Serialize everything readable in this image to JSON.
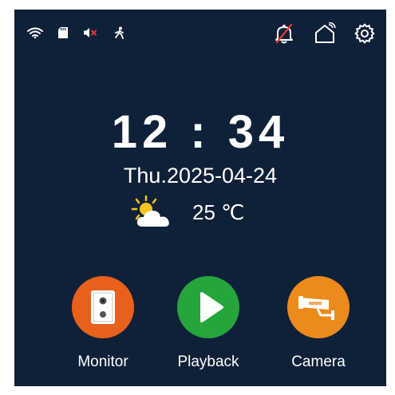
{
  "status_bar": {
    "left_icons": [
      "wifi-icon",
      "sd-card-icon",
      "speaker-muted-icon",
      "motion-detection-icon"
    ],
    "right_icons": [
      "alarm-off-icon",
      "home-icon",
      "settings-icon"
    ]
  },
  "clock": {
    "time": "12 : 34",
    "date": "Thu.2025-04-24"
  },
  "weather": {
    "icon": "partly-cloudy-icon",
    "temperature": "25 ℃"
  },
  "apps": [
    {
      "label": "Monitor",
      "icon": "intercom-panel-icon",
      "color": "#e8601c"
    },
    {
      "label": "Playback",
      "icon": "play-icon",
      "color": "#26a53c"
    },
    {
      "label": "Camera",
      "icon": "cctv-camera-icon",
      "color": "#ec8a1c"
    }
  ],
  "colors": {
    "background": "#0f2138",
    "alarm_off_slash": "#e53935",
    "muted_x": "#e53935"
  }
}
